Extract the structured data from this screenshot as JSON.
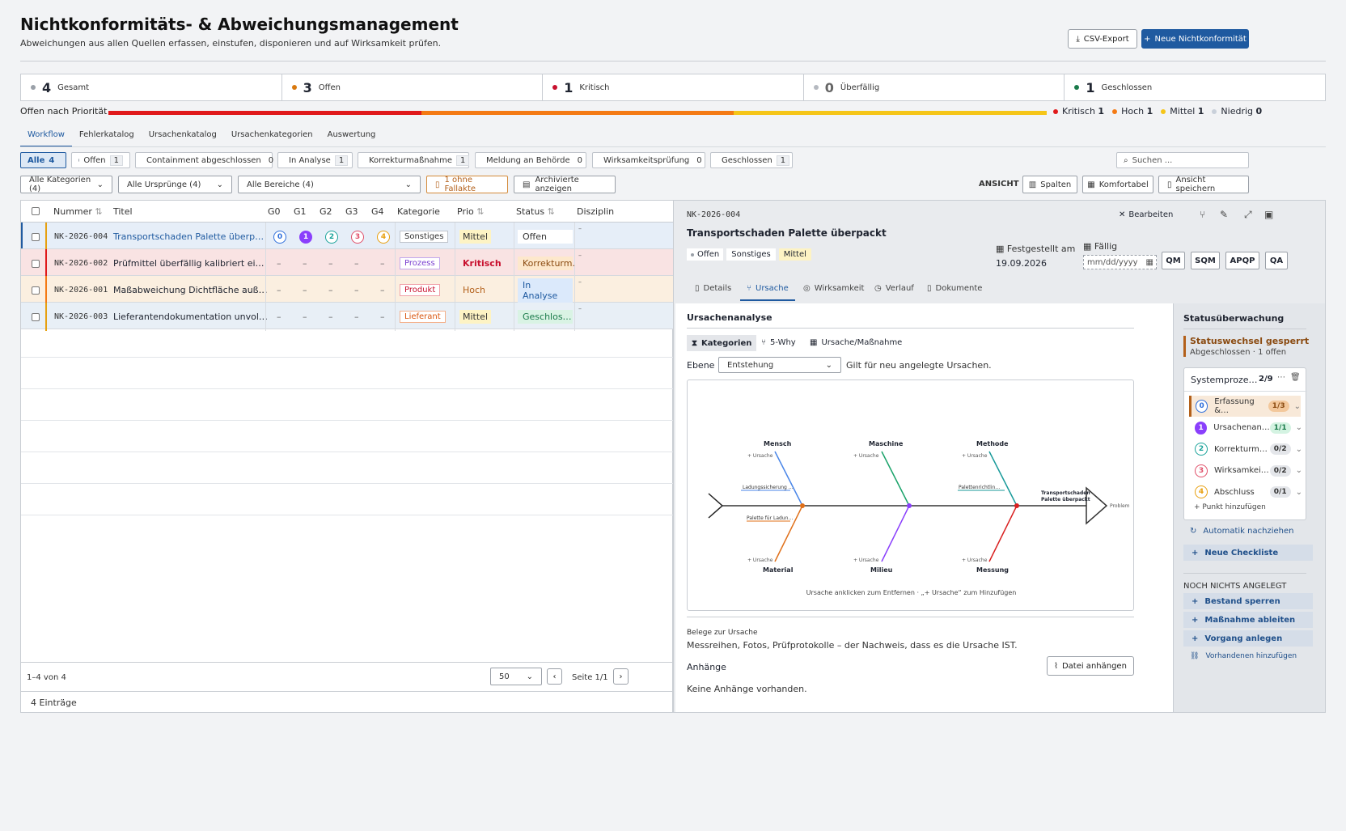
{
  "header": {
    "title": "Nichtkonformitäts- & Abweichungsmanagement",
    "subtitle": "Abweichungen aus allen Quellen erfassen, einstufen, disponieren und auf Wirksamkeit prüfen.",
    "csv_label": "CSV-Export",
    "new_label": "Neue Nichtkonformität"
  },
  "kpis": [
    {
      "num": "4",
      "label": "Gesamt",
      "color": "#9aa0a8"
    },
    {
      "num": "3",
      "label": "Offen",
      "color": "#d9790f"
    },
    {
      "num": "1",
      "label": "Kritisch",
      "color": "#c8102e"
    },
    {
      "num": "0",
      "label": "Überfällig",
      "color": "#b5b9c0"
    },
    {
      "num": "1",
      "label": "Geschlossen",
      "color": "#1a7a4a"
    }
  ],
  "priority": {
    "label": "Offen nach Priorität",
    "items": [
      {
        "name": "Kritisch",
        "count": "1",
        "color": "#e0191b",
        "share": 0.3333
      },
      {
        "name": "Hoch",
        "count": "1",
        "color": "#f47a14",
        "share": 0.3333
      },
      {
        "name": "Mittel",
        "count": "1",
        "color": "#f5c518",
        "share": 0.3334
      },
      {
        "name": "Niedrig",
        "count": "0",
        "color": "#c9d0da",
        "share": 0
      }
    ]
  },
  "tabs": [
    "Workflow",
    "Fehlerkatalog",
    "Ursachenkatalog",
    "Ursachenkategorien",
    "Auswertung"
  ],
  "status_chips": [
    {
      "label": "Alle",
      "count": "4",
      "color": ""
    },
    {
      "label": "Offen",
      "count": "1",
      "color": "#9aa0a8"
    },
    {
      "label": "Containment abgeschlossen",
      "count": "0",
      "color": "#f4b08a"
    },
    {
      "label": "In Analyse",
      "count": "1",
      "color": "#2f6fdb"
    },
    {
      "label": "Korrekturmaßnahme",
      "count": "1",
      "color": "#e08a10"
    },
    {
      "label": "Meldung an Behörde",
      "count": "0",
      "color": "#f08a8a"
    },
    {
      "label": "Wirksamkeitsprüfung",
      "count": "0",
      "color": "#c9a8e8"
    },
    {
      "label": "Geschlossen",
      "count": "1",
      "color": "#1a9a5a"
    }
  ],
  "search_placeholder": "Suchen ...",
  "filters": {
    "kategorien": "Alle Kategorien (4)",
    "urspruenge": "Alle Ursprünge (4)",
    "bereiche": "Alle Bereiche (4)",
    "fallakte": "1 ohne Fallakte",
    "archiv": "Archivierte anzeigen"
  },
  "view": {
    "label": "ANSICHT",
    "spalten": "Spalten",
    "komfort": "Komfortabel",
    "speichern": "Ansicht speichern"
  },
  "table": {
    "headers": [
      "Nummer",
      "Titel",
      "G0",
      "G1",
      "G2",
      "G3",
      "G4",
      "Kategorie",
      "Prio",
      "Status",
      "Disziplin"
    ],
    "rows": [
      {
        "nummer": "NK-2026-004",
        "titel": "Transportschaden Palette überp…",
        "kategorie": "Sonstiges",
        "prio": "Mittel",
        "status": "Offen"
      },
      {
        "nummer": "NK-2026-002",
        "titel": "Prüfmittel überfällig kalibriert ei…",
        "kategorie": "Prozess",
        "prio": "Kritisch",
        "status": "Korrekturm."
      },
      {
        "nummer": "NK-2026-001",
        "titel": "Maßabweichung Dichtfläche auß…",
        "kategorie": "Produkt",
        "prio": "Hoch",
        "status": "In Analyse"
      },
      {
        "nummer": "NK-2026-003",
        "titel": "Lieferantendokumentation unvol…",
        "kategorie": "Lieferant",
        "prio": "Mittel",
        "status": "Geschlos…"
      }
    ],
    "gates": [
      "0",
      "1",
      "2",
      "3",
      "4"
    ],
    "dash": "–",
    "range": "1–4 von 4",
    "page_size": "50",
    "page": "Seite 1/1",
    "entries": "4 Einträge"
  },
  "detail": {
    "number": "NK-2026-004",
    "title": "Transportschaden Palette überpackt",
    "badges": [
      "Offen",
      "Sonstiges",
      "Mittel"
    ],
    "edit": "Bearbeiten",
    "found_label": "Festgestellt am",
    "found_date": "19.09.2026",
    "due_label": "Fällig",
    "due_placeholder": "mm/dd/yyyy",
    "actions": [
      "QM",
      "SQM",
      "APQP",
      "QA"
    ],
    "tabs": [
      "Details",
      "Ursache",
      "Wirksamkeit",
      "Verlauf",
      "Dokumente"
    ],
    "section_title": "Ursachenanalyse",
    "subtabs": [
      "Kategorien",
      "5-Why",
      "Ursache/Maßnahme"
    ],
    "ebene_label": "Ebene",
    "ebene_value": "Entstehung",
    "ebene_hint": "Gilt für neu angelegte Ursachen.",
    "fishbone": {
      "top": [
        "Mensch",
        "Maschine",
        "Methode"
      ],
      "bottom": [
        "Material",
        "Milieu",
        "Messung"
      ],
      "add": "+ Ursache",
      "causes": [
        "Ladungssicherung …",
        "Palette für Ladun…",
        "Palettenrichtlin…"
      ],
      "problem_lines": [
        "Transportschaden",
        "Palette überpackt"
      ],
      "problem_label": "Problem",
      "hint": "Ursache anklicken zum Entfernen · „+ Ursache“ zum Hinzufügen"
    },
    "evidence_label": "Belege zur Ursache",
    "evidence_text": "Messreihen, Fotos, Prüfprotokolle – der Nachweis, dass es die Ursache IST.",
    "attachments_label": "Anhänge",
    "attach_button": "Datei anhängen",
    "no_attachments": "Keine Anhänge vorhanden."
  },
  "sidebar": {
    "title": "Statusüberwachung",
    "locked": "Statuswechsel gesperrt",
    "locked_sub": "Abgeschlossen · 1 offen",
    "checklist_title": "Systemproze…",
    "checklist_count": "2/9",
    "phases": [
      {
        "n": "0",
        "label": "Erfassung &…",
        "count": "1/3",
        "color": "#2f6fdb"
      },
      {
        "n": "1",
        "label": "Ursachenan…",
        "count": "1/1",
        "color": "#8a3ffc"
      },
      {
        "n": "2",
        "label": "Korrekturm…",
        "count": "0/2",
        "color": "#1aa39a"
      },
      {
        "n": "3",
        "label": "Wirksamkei…",
        "count": "0/2",
        "color": "#e0506a"
      },
      {
        "n": "4",
        "label": "Abschluss",
        "count": "0/1",
        "color": "#e8a010"
      }
    ],
    "add_point": "+ Punkt hinzufügen",
    "auto": "Automatik nachziehen",
    "new_checklist": "Neue Checkliste",
    "nothing": "NOCH NICHTS ANGELEGT",
    "actions": [
      "Bestand sperren",
      "Maßnahme ableiten",
      "Vorgang anlegen"
    ],
    "link_existing": "Vorhandenen hinzufügen"
  }
}
